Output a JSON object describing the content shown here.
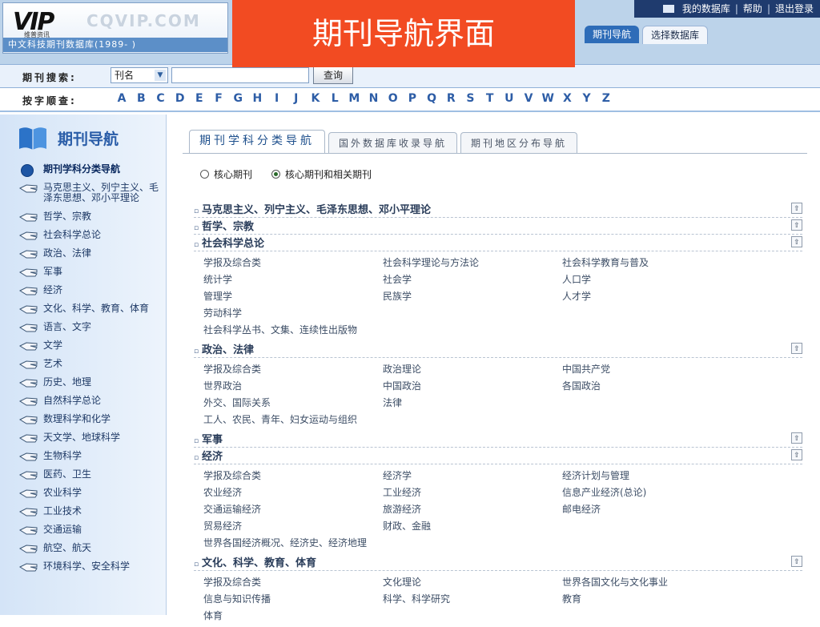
{
  "header": {
    "logo_mark": "VIP",
    "logo_tagline": "维普资讯",
    "logo_brand": "CQVIP.COM",
    "logo_subtitle": "中文科技期刊数据库(1989- )",
    "top_links": [
      "我的数据库",
      "帮助",
      "退出登录"
    ],
    "top_link_separator": "|",
    "nav_tabs": [
      "期刊导航",
      "选择数据库"
    ],
    "banner_title": "期刊导航界面"
  },
  "search": {
    "label": "期刊搜索:",
    "field_selected": "刊名",
    "input_value": "",
    "button_label": "查询"
  },
  "alphabet": {
    "label": "按字顺查:",
    "letters": [
      "A",
      "B",
      "C",
      "D",
      "E",
      "F",
      "G",
      "H",
      "I",
      "J",
      "K",
      "L",
      "M",
      "N",
      "O",
      "P",
      "Q",
      "R",
      "S",
      "T",
      "U",
      "V",
      "W",
      "X",
      "Y",
      "Z"
    ]
  },
  "sidebar": {
    "title": "期刊导航",
    "items": [
      {
        "label": "期刊学科分类导航",
        "active": true
      },
      {
        "label": "马克思主义、列宁主义、毛泽东思想、邓小平理论"
      },
      {
        "label": "哲学、宗教"
      },
      {
        "label": "社会科学总论"
      },
      {
        "label": "政治、法律"
      },
      {
        "label": "军事"
      },
      {
        "label": "经济"
      },
      {
        "label": "文化、科学、教育、体育"
      },
      {
        "label": "语言、文字"
      },
      {
        "label": "文学"
      },
      {
        "label": "艺术"
      },
      {
        "label": "历史、地理"
      },
      {
        "label": "自然科学总论"
      },
      {
        "label": "数理科学和化学"
      },
      {
        "label": "天文学、地球科学"
      },
      {
        "label": "生物科学"
      },
      {
        "label": "医药、卫生"
      },
      {
        "label": "农业科学"
      },
      {
        "label": "工业技术"
      },
      {
        "label": "交通运输"
      },
      {
        "label": "航空、航天"
      },
      {
        "label": "环境科学、安全科学"
      }
    ]
  },
  "main": {
    "tabs": [
      "期刊学科分类导航",
      "国外数据库收录导航",
      "期刊地区分布导航"
    ],
    "radios": [
      {
        "label": "核心期刊",
        "checked": false
      },
      {
        "label": "核心期刊和相关期刊",
        "checked": true
      }
    ],
    "categories": [
      {
        "title": "马克思主义、列宁主义、毛泽东思想、邓小平理论",
        "items": []
      },
      {
        "title": "哲学、宗教",
        "items": []
      },
      {
        "title": "社会科学总论",
        "items": [
          "学报及综合类",
          "社会科学理论与方法论",
          "社会科学教育与普及",
          "统计学",
          "社会学",
          "人口学",
          "管理学",
          "民族学",
          "人才学",
          "劳动科学",
          "社会科学丛书、文集、连续性出版物"
        ]
      },
      {
        "title": "政治、法律",
        "items": [
          "学报及综合类",
          "政治理论",
          "中国共产党",
          "世界政治",
          "中国政治",
          "各国政治",
          "外交、国际关系",
          "法律",
          "工人、农民、青年、妇女运动与组织"
        ]
      },
      {
        "title": "军事",
        "items": []
      },
      {
        "title": "经济",
        "items": [
          "学报及综合类",
          "经济学",
          "经济计划与管理",
          "农业经济",
          "工业经济",
          "信息产业经济(总论)",
          "交通运输经济",
          "旅游经济",
          "邮电经济",
          "贸易经济",
          "财政、金融",
          "世界各国经济概况、经济史、经济地理"
        ]
      },
      {
        "title": "文化、科学、教育、体育",
        "items": [
          "学报及综合类",
          "文化理论",
          "世界各国文化与文化事业",
          "信息与知识传播",
          "科学、科学研究",
          "教育",
          "体育"
        ]
      }
    ],
    "bullet_glyph": "▫",
    "collapse_glyph": "⇧"
  },
  "colors": {
    "banner": "#f24b22",
    "header_bg": "#bcd3ea",
    "accent": "#2e6cb8",
    "alpha_letter": "#2d5da6"
  }
}
